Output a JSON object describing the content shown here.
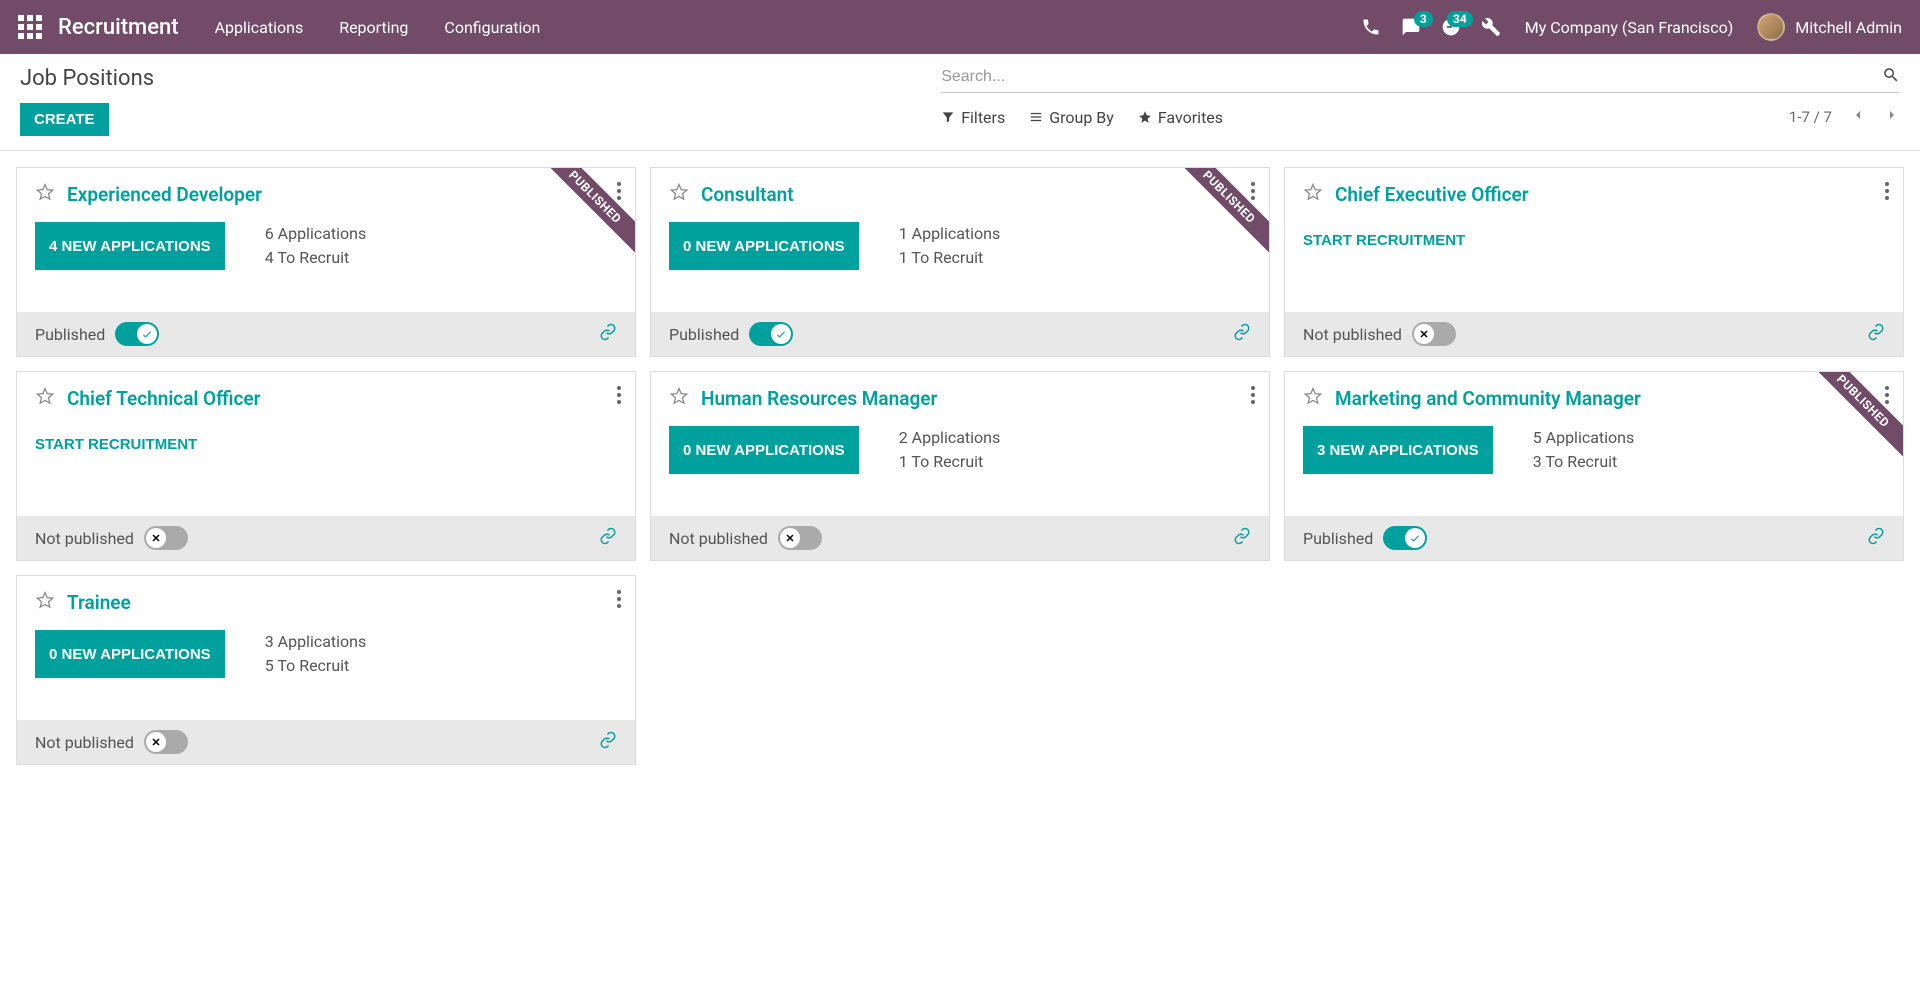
{
  "topnav": {
    "brand": "Recruitment",
    "links": [
      "Applications",
      "Reporting",
      "Configuration"
    ],
    "messages_badge": "3",
    "activities_badge": "34",
    "company": "My Company (San Francisco)",
    "user": "Mitchell Admin"
  },
  "controlPanel": {
    "title": "Job Positions",
    "create": "CREATE",
    "searchPlaceholder": "Search...",
    "filters": "Filters",
    "groupBy": "Group By",
    "favorites": "Favorites",
    "pager": "1-7 / 7"
  },
  "ribbonText": "PUBLISHED",
  "publishedLabel": "Published",
  "notPublishedLabel": "Not published",
  "startRecruitment": "START RECRUITMENT",
  "cards": [
    {
      "title": "Experienced Developer",
      "appsButton": "4 NEW APPLICATIONS",
      "applications": "6 Applications",
      "toRecruit": "4 To Recruit",
      "published": true,
      "ribbon": true,
      "hasStats": true,
      "startOnly": false
    },
    {
      "title": "Consultant",
      "appsButton": "0 NEW APPLICATIONS",
      "applications": "1 Applications",
      "toRecruit": "1 To Recruit",
      "published": true,
      "ribbon": true,
      "hasStats": true,
      "startOnly": false
    },
    {
      "title": "Chief Executive Officer",
      "appsButton": "",
      "applications": "",
      "toRecruit": "",
      "published": false,
      "ribbon": false,
      "hasStats": false,
      "startOnly": true
    },
    {
      "title": "Chief Technical Officer",
      "appsButton": "",
      "applications": "",
      "toRecruit": "",
      "published": false,
      "ribbon": false,
      "hasStats": false,
      "startOnly": true
    },
    {
      "title": "Human Resources Manager",
      "appsButton": "0 NEW APPLICATIONS",
      "applications": "2 Applications",
      "toRecruit": "1 To Recruit",
      "published": false,
      "ribbon": false,
      "hasStats": true,
      "startOnly": false
    },
    {
      "title": "Marketing and Community Manager",
      "appsButton": "3 NEW APPLICATIONS",
      "applications": "5 Applications",
      "toRecruit": "3 To Recruit",
      "published": true,
      "ribbon": true,
      "hasStats": true,
      "startOnly": false
    },
    {
      "title": "Trainee",
      "appsButton": "0 NEW APPLICATIONS",
      "applications": "3 Applications",
      "toRecruit": "5 To Recruit",
      "published": false,
      "ribbon": false,
      "hasStats": true,
      "startOnly": false
    }
  ]
}
